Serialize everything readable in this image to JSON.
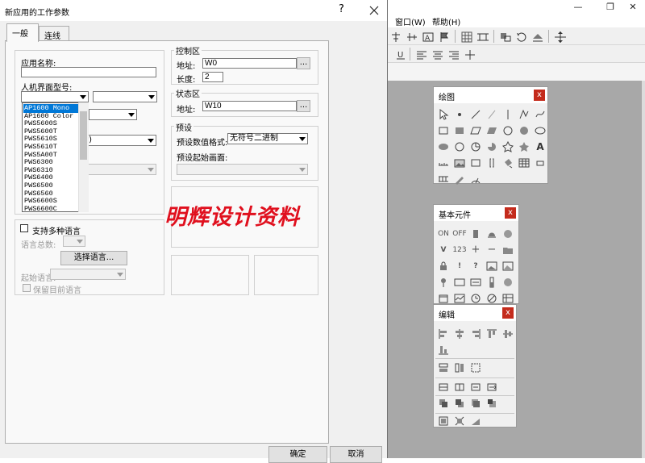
{
  "app": {
    "menu": [
      "窗口(W)",
      "帮助(H)"
    ],
    "window_controls": [
      "minimize",
      "restore",
      "close"
    ]
  },
  "dialog": {
    "title": "新应用的工作参数",
    "help": "?",
    "close": "X",
    "tabs": [
      "一般",
      "连线"
    ],
    "app_name_label": "应用名称:",
    "app_name_value": "",
    "hmi_model_label": "人机界面型号:",
    "model_list": [
      "AP1600 Mono",
      "AP1600 Color",
      "PWS5600S",
      "PWS5600T",
      "PWS5610S",
      "PWS5610T",
      "PWS5A00T",
      "PWS6300",
      "PWS6310",
      "PWS6400",
      "PWS6500",
      "PWS6560",
      "PWS6600S",
      "PWS6600C"
    ],
    "model_list_selected": 0,
    "partial_combo_text": "r)",
    "control_group": "控制区",
    "ctrl_addr_label": "地址:",
    "ctrl_addr_value": "W0",
    "ctrl_len_label": "长度:",
    "ctrl_len_value": "2",
    "status_group": "状态区",
    "stat_addr_label": "地址:",
    "stat_addr_value": "W10",
    "browse": "...",
    "preset_group": "预设",
    "preset_format_label": "预设数值格式:",
    "preset_format_value": "无符号二进制",
    "preset_start_label": "预设起始画面:",
    "multilang_label": "支持多种语言",
    "lang_count_label": "语言总数:",
    "select_lang_button": "选择语言...",
    "start_lang_label": "起始语言:",
    "keep_lang_label": "保留目前语言",
    "ok_button": "确定",
    "cancel_button": "取消"
  },
  "palettes": {
    "drawing": {
      "title": "绘图",
      "close": "x"
    },
    "basic": {
      "title": "基本元件",
      "close": "x",
      "labels": [
        "ON",
        "OFF",
        "V",
        "123",
        "+",
        "−",
        "!",
        "?"
      ]
    },
    "edit": {
      "title": "编辑",
      "close": "x"
    }
  },
  "watermark": "明辉设计资料",
  "colors": {
    "accent": "#0078d7",
    "close": "#c42b1c",
    "watermark": "#e0101e",
    "workspace": "#a8a8a8"
  }
}
